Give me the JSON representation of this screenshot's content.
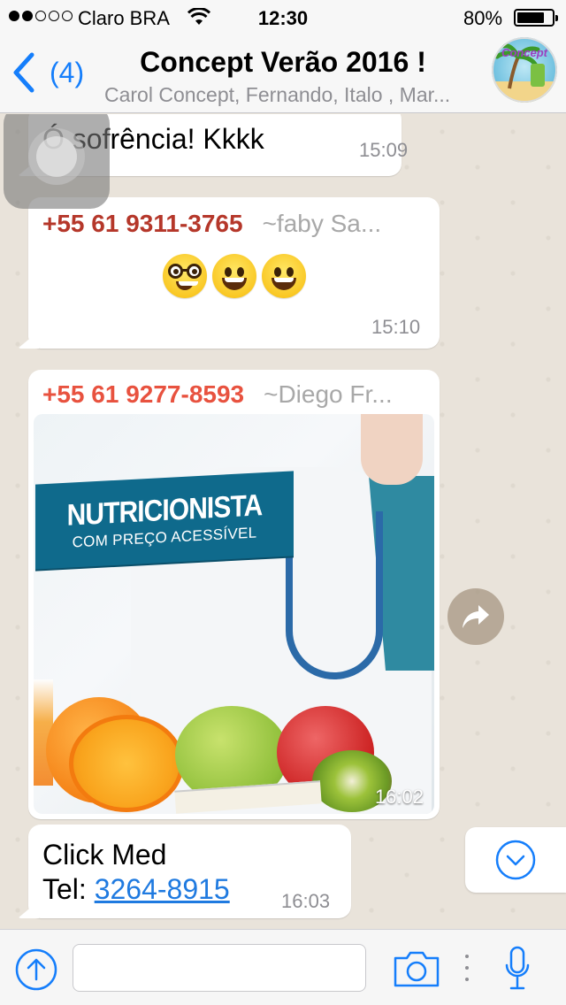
{
  "status_bar": {
    "carrier": "Claro BRA",
    "time": "12:30",
    "battery_percent": "80%",
    "battery_level": 0.8,
    "signal_bars": 2,
    "signal_total": 5
  },
  "header": {
    "back_count": "(4)",
    "title": "Concept Verão 2016 !",
    "subtitle": "Carol Concept, Fernando, Italo , Mar..."
  },
  "messages": [
    {
      "text": "Ó sofrência! Kkkk",
      "time": "15:09"
    },
    {
      "sender_phone": "+55 61 9311-3765",
      "sender_name": "~faby Sa...",
      "emojis": [
        "nerd-face",
        "grinning-face",
        "grinning-face"
      ],
      "time": "15:10"
    },
    {
      "sender_phone": "+55 61 9277-8593",
      "sender_name": "~Diego Fr...",
      "image": {
        "banner_title": "NUTRICIONISTA",
        "banner_subtitle": "COM PREÇO ACESSÍVEL"
      },
      "time": "16:02"
    },
    {
      "line1": "Click Med",
      "line2_label": "Tel: ",
      "phone_link": "3264-8915",
      "time": "16:03"
    }
  ],
  "icons": {
    "back": "chevron-left-icon",
    "forward": "share-icon",
    "scroll_down": "chevron-down-icon",
    "attach": "upload-arrow-icon",
    "camera": "camera-icon",
    "mic": "microphone-icon"
  },
  "colors": {
    "accent": "#157efb",
    "sender1": "#b5372a",
    "sender2": "#e8523f",
    "chat_bg": "#e9e3da",
    "link": "#1f7ae0"
  },
  "input": {
    "value": "",
    "placeholder": ""
  }
}
